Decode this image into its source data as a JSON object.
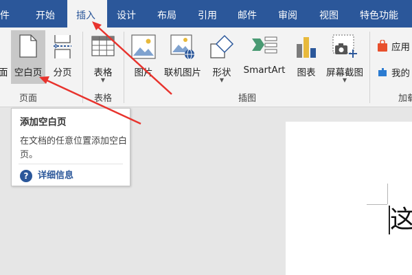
{
  "tabs": [
    {
      "label": "件",
      "active": false
    },
    {
      "label": "开始",
      "active": false
    },
    {
      "label": "插入",
      "active": true
    },
    {
      "label": "设计",
      "active": false
    },
    {
      "label": "布局",
      "active": false
    },
    {
      "label": "引用",
      "active": false
    },
    {
      "label": "邮件",
      "active": false
    },
    {
      "label": "审阅",
      "active": false
    },
    {
      "label": "视图",
      "active": false
    },
    {
      "label": "特色功能",
      "active": false
    }
  ],
  "ribbon": {
    "pages": {
      "cover_partial": "面",
      "blank_page": "空白页",
      "page_break": "分页",
      "group": "页面"
    },
    "tables": {
      "table": "表格",
      "group": "表格"
    },
    "illustrations": {
      "pictures": "图片",
      "online_pictures": "联机图片",
      "shapes": "形状",
      "smartart": "SmartArt",
      "chart": "图表",
      "screenshot": "屏幕截图",
      "group": "插图"
    },
    "addins": {
      "store": "应用",
      "my_addins": "我的",
      "group": "加载"
    }
  },
  "tooltip": {
    "title": "添加空白页",
    "body": "在文档的任意位置添加空白页。",
    "help": "详细信息"
  },
  "document": {
    "text": "这"
  },
  "colors": {
    "accent": "#2b579a",
    "ribbon_bg": "#f3f3f3",
    "annotation": "#e8332d"
  }
}
